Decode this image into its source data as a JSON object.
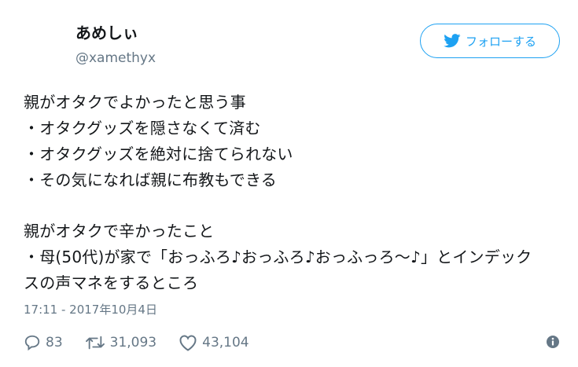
{
  "user": {
    "display_name": "あめしぃ",
    "handle": "@xamethyx"
  },
  "follow_button": {
    "label": "フォローする",
    "icon": "twitter-bird-icon",
    "color": "#1da1f2"
  },
  "tweet": {
    "lines": [
      "親がオタクでよかったと思う事",
      "・オタクグッズを隠さなくて済む",
      "・オタクグッズを絶対に捨てられない",
      "・その気になれば親に布教もできる",
      "",
      "親がオタクで辛かったこと",
      "・母(50代)が家で「おっふろ♪おっふろ♪おっふっろ～♪」とインデック",
      "スの声マネをするところ"
    ],
    "timestamp": "17:11 - 2017年10月4日"
  },
  "stats": {
    "replies": "83",
    "retweets": "31,093",
    "likes": "43,104"
  },
  "icons": {
    "reply": "reply-icon",
    "retweet": "retweet-icon",
    "like": "heart-icon",
    "info": "info-icon"
  }
}
